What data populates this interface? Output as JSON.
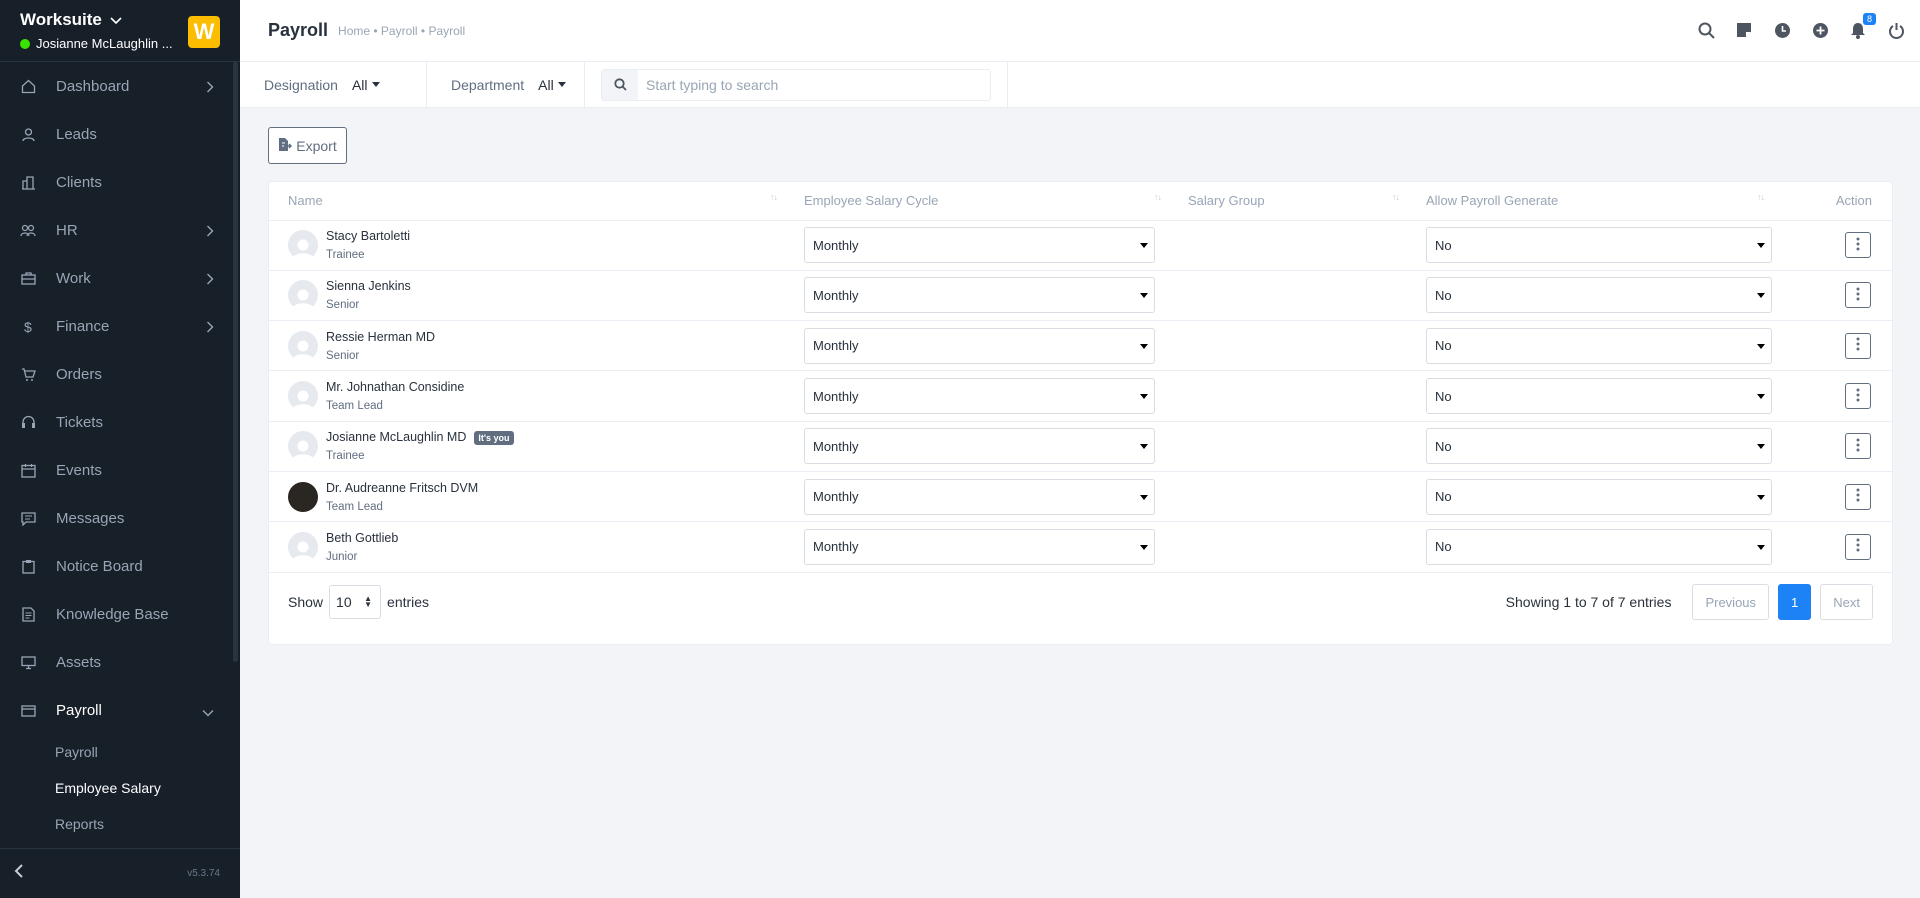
{
  "sidebar": {
    "app_name": "Worksuite",
    "user_name": "Josianne McLaughlin ...",
    "logo_letter": "W",
    "items": [
      {
        "label": "Dashboard",
        "icon": "house-icon",
        "has_chevron": true
      },
      {
        "label": "Leads",
        "icon": "person-icon",
        "has_chevron": false
      },
      {
        "label": "Clients",
        "icon": "building-icon",
        "has_chevron": false
      },
      {
        "label": "HR",
        "icon": "people-icon",
        "has_chevron": true
      },
      {
        "label": "Work",
        "icon": "briefcase-icon",
        "has_chevron": true
      },
      {
        "label": "Finance",
        "icon": "dollar-icon",
        "has_chevron": true
      },
      {
        "label": "Orders",
        "icon": "cart-icon",
        "has_chevron": false
      },
      {
        "label": "Tickets",
        "icon": "headset-icon",
        "has_chevron": false
      },
      {
        "label": "Events",
        "icon": "calendar-icon",
        "has_chevron": false
      },
      {
        "label": "Messages",
        "icon": "chat-icon",
        "has_chevron": false
      },
      {
        "label": "Notice Board",
        "icon": "clipboard-icon",
        "has_chevron": false
      },
      {
        "label": "Knowledge Base",
        "icon": "document-icon",
        "has_chevron": false
      },
      {
        "label": "Assets",
        "icon": "monitor-icon",
        "has_chevron": false
      },
      {
        "label": "Payroll",
        "icon": "wallet-icon",
        "has_chevron": true
      }
    ],
    "payroll_sub": [
      "Payroll",
      "Employee Salary",
      "Reports"
    ],
    "version": "v5.3.74"
  },
  "header": {
    "title": "Payroll",
    "breadcrumb": "Home • Payroll • Payroll",
    "notification_count": "8"
  },
  "filters": {
    "designation_label": "Designation",
    "designation_value": "All",
    "department_label": "Department",
    "department_value": "All",
    "search_placeholder": "Start typing to search"
  },
  "export_label": "Export",
  "table": {
    "columns": [
      "Name",
      "Employee Salary Cycle",
      "Salary Group",
      "Allow Payroll Generate",
      "Action"
    ],
    "rows": [
      {
        "name": "Stacy Bartoletti",
        "role": "Trainee",
        "cycle": "Monthly",
        "group": "",
        "allow": "No"
      },
      {
        "name": "Sienna Jenkins",
        "role": "Senior",
        "cycle": "Monthly",
        "group": "",
        "allow": "No"
      },
      {
        "name": "Ressie Herman MD",
        "role": "Senior",
        "cycle": "Monthly",
        "group": "",
        "allow": "No"
      },
      {
        "name": "Mr. Johnathan Considine",
        "role": "Team Lead",
        "cycle": "Monthly",
        "group": "",
        "allow": "No"
      },
      {
        "name": "Josianne McLaughlin MD",
        "role": "Trainee",
        "cycle": "Monthly",
        "group": "",
        "allow": "No",
        "badge": "It's you"
      },
      {
        "name": "Dr. Audreanne Fritsch DVM",
        "role": "Team Lead",
        "cycle": "Monthly",
        "group": "",
        "allow": "No",
        "photo": true
      },
      {
        "name": "Beth Gottlieb",
        "role": "Junior",
        "cycle": "Monthly",
        "group": "",
        "allow": "No"
      }
    ]
  },
  "footer": {
    "show_label": "Show",
    "page_length": "10",
    "entries_label": "entries",
    "info": "Showing 1 to 7 of 7 entries",
    "previous": "Previous",
    "current_page": "1",
    "next": "Next"
  },
  "colors": {
    "sidebar_bg": "#171f29",
    "accent": "#1d82f5",
    "logo_bg": "#fcbd01",
    "online": "#39e500"
  }
}
